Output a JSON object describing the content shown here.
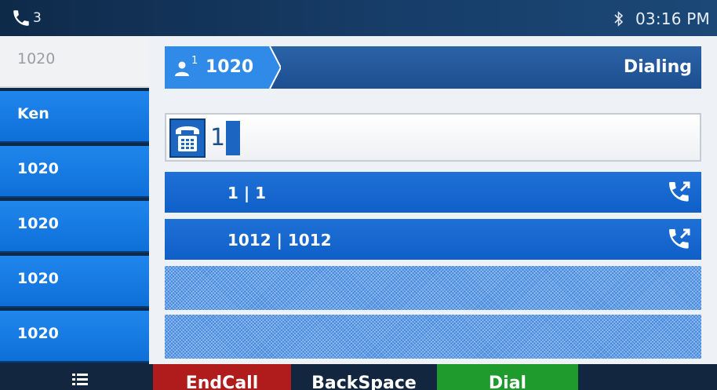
{
  "status_bar": {
    "line_count": "3",
    "time": "03:16 PM",
    "icons": [
      "phone-icon",
      "bluetooth-icon"
    ]
  },
  "sidebar": {
    "items": [
      {
        "label": "1020",
        "active": true
      },
      {
        "label": "Ken",
        "active": false
      },
      {
        "label": "1020",
        "active": false
      },
      {
        "label": "1020",
        "active": false
      },
      {
        "label": "1020",
        "active": false
      },
      {
        "label": "1020",
        "active": false
      }
    ]
  },
  "header": {
    "line_superscript": "1",
    "line_label": "1020",
    "status": "Dialing"
  },
  "dial_input": {
    "value": "1"
  },
  "suggestions": [
    {
      "text": "1 | 1"
    },
    {
      "text": "1012 | 1012"
    }
  ],
  "softkeys": {
    "endcall": "EndCall",
    "backspace": "BackSpace",
    "dial": "Dial"
  },
  "colors": {
    "accent": "#1c66c2",
    "endcall": "#b01b1b",
    "dial": "#1f9a2c"
  }
}
